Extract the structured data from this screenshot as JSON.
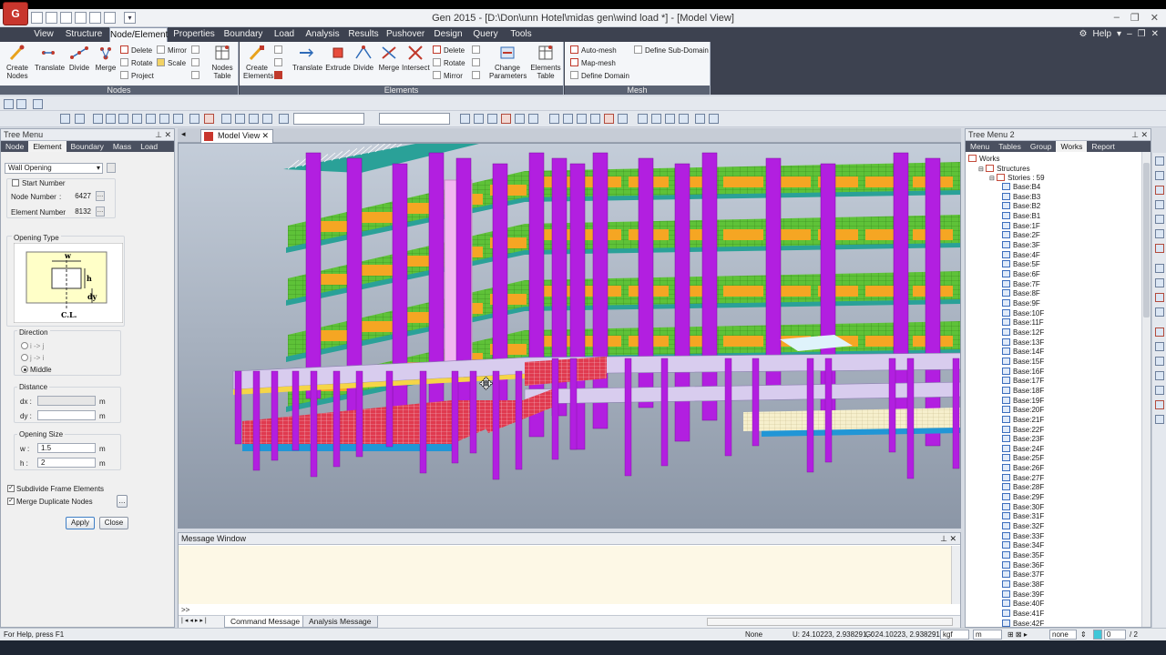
{
  "window": {
    "title": "Gen 2015 - [D:\\Don\\unn Hotel\\midas gen\\wind load *] - [Model View]",
    "app_logo": "G"
  },
  "ribbon_tabs": [
    "View",
    "Structure",
    "Node/Element",
    "Properties",
    "Boundary",
    "Load",
    "Analysis",
    "Results",
    "Pushover",
    "Design",
    "Query",
    "Tools"
  ],
  "active_tab": "Node/Element",
  "help_label": "Help",
  "ribbon": {
    "nodes": {
      "label": "Nodes",
      "buttons": [
        "Create Nodes",
        "Translate",
        "Divide",
        "Merge"
      ],
      "small": [
        "Delete",
        "Rotate",
        "Project",
        "Mirror",
        "Scale"
      ],
      "table": "Nodes Table"
    },
    "elements": {
      "label": "Elements",
      "buttons": [
        "Create Elements",
        "Translate",
        "Extrude",
        "Divide",
        "Merge",
        "Intersect"
      ],
      "small": [
        "Delete",
        "Rotate",
        "Mirror"
      ],
      "change": "Change Parameters",
      "table": "Elements Table"
    },
    "mesh": {
      "label": "Mesh",
      "small": [
        "Auto-mesh",
        "Map-mesh",
        "Define Domain",
        "Define Sub-Domain"
      ]
    }
  },
  "left_panel": {
    "title": "Tree Menu",
    "tabs": [
      "Node",
      "Element",
      "Boundary",
      "Mass",
      "Load"
    ],
    "active_tab": "Element",
    "function_select": "Wall Opening",
    "start_number_label": "Start Number",
    "node_number_label": "Node Number",
    "node_number": "6427",
    "element_number_label": "Element Number",
    "element_number": "8132",
    "opening_type_label": "Opening Type",
    "diagram_labels": {
      "w": "w",
      "h": "h",
      "dy": "dy",
      "cl": "C.L."
    },
    "direction_label": "Direction",
    "directions": [
      "i -> j",
      "j -> i",
      "Middle"
    ],
    "selected_direction": "Middle",
    "distance_label": "Distance",
    "dx_label": "dx :",
    "dx_value": "",
    "dy_label": "dy :",
    "dy_value": "",
    "unit": "m",
    "opening_size_label": "Opening Size",
    "w_label": "w :",
    "w_value": "1.5",
    "h_label": "h :",
    "h_value": "2",
    "subdivide_label": "Subdivide Frame Elements",
    "merge_label": "Merge Duplicate Nodes",
    "apply_label": "Apply",
    "close_label": "Close"
  },
  "model_view": {
    "tab_label": "Model View",
    "colors": {
      "background_top": "#c4cdd9",
      "background_bottom": "#8b96a6",
      "column": "#b21fe0",
      "beam_orange": "#f5a623",
      "slab_green": "#5ec238",
      "deck_teal": "#2aa198",
      "mesh_red": "#e03a4f",
      "mesh_blue": "#2196d6",
      "beam_light": "#d8ccee"
    }
  },
  "message_window": {
    "title": "Message Window",
    "prompt": ">>",
    "tabs": [
      "Command Message",
      "Analysis Message"
    ],
    "active_tab": "Command Message"
  },
  "right_panel": {
    "title": "Tree Menu 2",
    "tabs": [
      "Menu",
      "Tables",
      "Group",
      "Works",
      "Report"
    ],
    "active_tab": "Works",
    "root": "Works",
    "structures": "Structures",
    "stories_label": "Stories : 59",
    "stories": [
      "Base:B4",
      "Base:B3",
      "Base:B2",
      "Base:B1",
      "Base:1F",
      "Base:2F",
      "Base:3F",
      "Base:4F",
      "Base:5F",
      "Base:6F",
      "Base:7F",
      "Base:8F",
      "Base:9F",
      "Base:10F",
      "Base:11F",
      "Base:12F",
      "Base:13F",
      "Base:14F",
      "Base:15F",
      "Base:16F",
      "Base:17F",
      "Base:18F",
      "Base:19F",
      "Base:20F",
      "Base:21F",
      "Base:22F",
      "Base:23F",
      "Base:24F",
      "Base:25F",
      "Base:26F",
      "Base:27F",
      "Base:28F",
      "Base:29F",
      "Base:30F",
      "Base:31F",
      "Base:32F",
      "Base:33F",
      "Base:34F",
      "Base:35F",
      "Base:36F",
      "Base:37F",
      "Base:38F",
      "Base:39F",
      "Base:40F",
      "Base:41F",
      "Base:42F"
    ]
  },
  "status": {
    "help": "For Help, press F1",
    "snap": "None",
    "u_coord": "U: 24.10223, 2.938291, 0",
    "g_coord": "G: 24.10223, 2.938291, 0",
    "force_unit": "kgf",
    "length_unit": "m",
    "mode": "none",
    "zero": "0",
    "page": "2"
  }
}
